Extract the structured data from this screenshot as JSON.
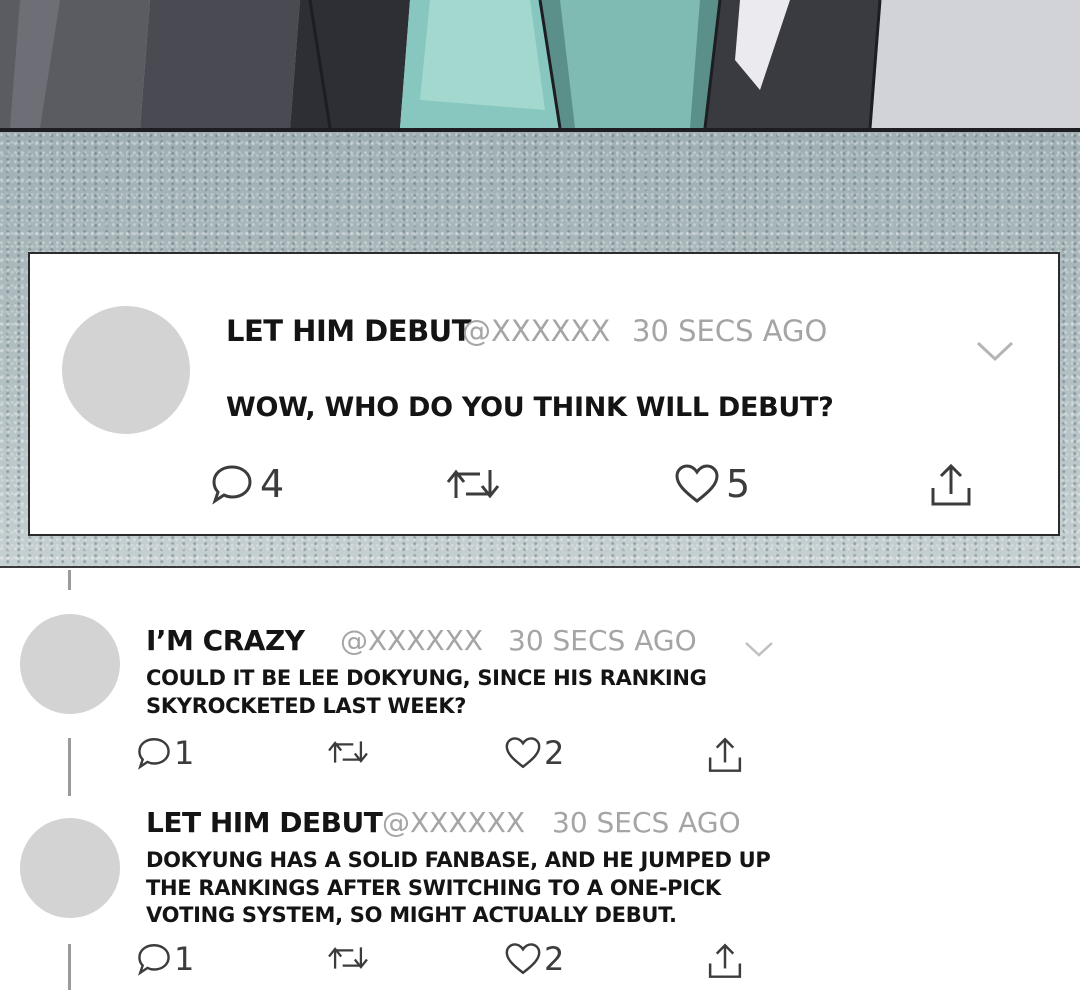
{
  "main_post": {
    "name": "LET HIM DEBUT",
    "handle": "@XXXXXX",
    "time": "30 SECS AGO",
    "text": "WOW, WHO DO YOU THINK WILL DEBUT?",
    "replies": "4",
    "likes": "5"
  },
  "replies": [
    {
      "name": "I’M CRAZY",
      "handle": "@XXXXXX",
      "time": "30 SECS AGO",
      "text_line1": "COULD IT BE LEE DOKYUNG, SINCE HIS RANKING",
      "text_line2": "SKYROCKETED LAST WEEK?",
      "replies": "1",
      "likes": "2"
    },
    {
      "name": "LET HIM DEBUT",
      "handle": "@XXXXXX",
      "time": "30 SECS AGO",
      "text_line1": "DOKYUNG HAS A SOLID FANBASE, AND HE JUMPED UP",
      "text_line2": "THE RANKINGS AFTER SWITCHING TO A ONE-PICK",
      "text_line3": "VOTING SYSTEM, SO MIGHT ACTUALLY DEBUT.",
      "replies": "1",
      "likes": "2"
    }
  ],
  "icons": {
    "reply": "speech-bubble-icon",
    "retweet": "retweet-icon",
    "like": "heart-icon",
    "share": "share-icon",
    "menu": "chevron-down-icon"
  },
  "colors": {
    "text": "#141414",
    "muted": "#a5a5a5",
    "avatar": "#d3d3d3",
    "texture": "#a9b7bb"
  }
}
